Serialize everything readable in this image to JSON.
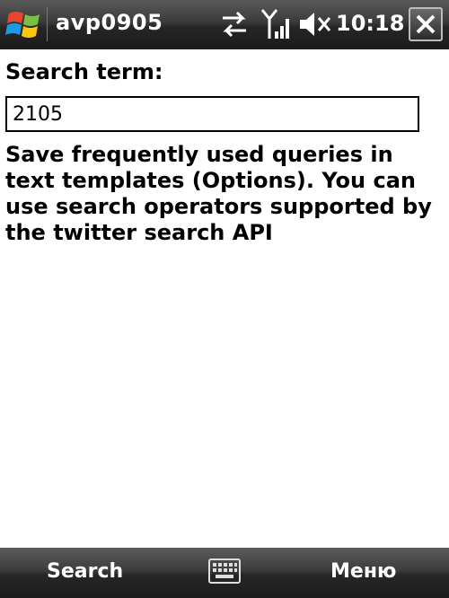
{
  "titlebar": {
    "title": "avp0905",
    "clock": "10:18",
    "start_icon": "windows-flag-icon",
    "status_icons": [
      "connectivity-icon",
      "signal-icon",
      "volume-muted-icon"
    ],
    "close_icon": "close-icon"
  },
  "form": {
    "search_label": "Search term:",
    "search_value": "2105",
    "help_text": "Save frequently used queries in text templates (Options). You can use search operators supported by the twitter search API"
  },
  "softkeys": {
    "left_label": "Search",
    "right_label": "Меню",
    "center_icon": "keyboard-icon"
  }
}
